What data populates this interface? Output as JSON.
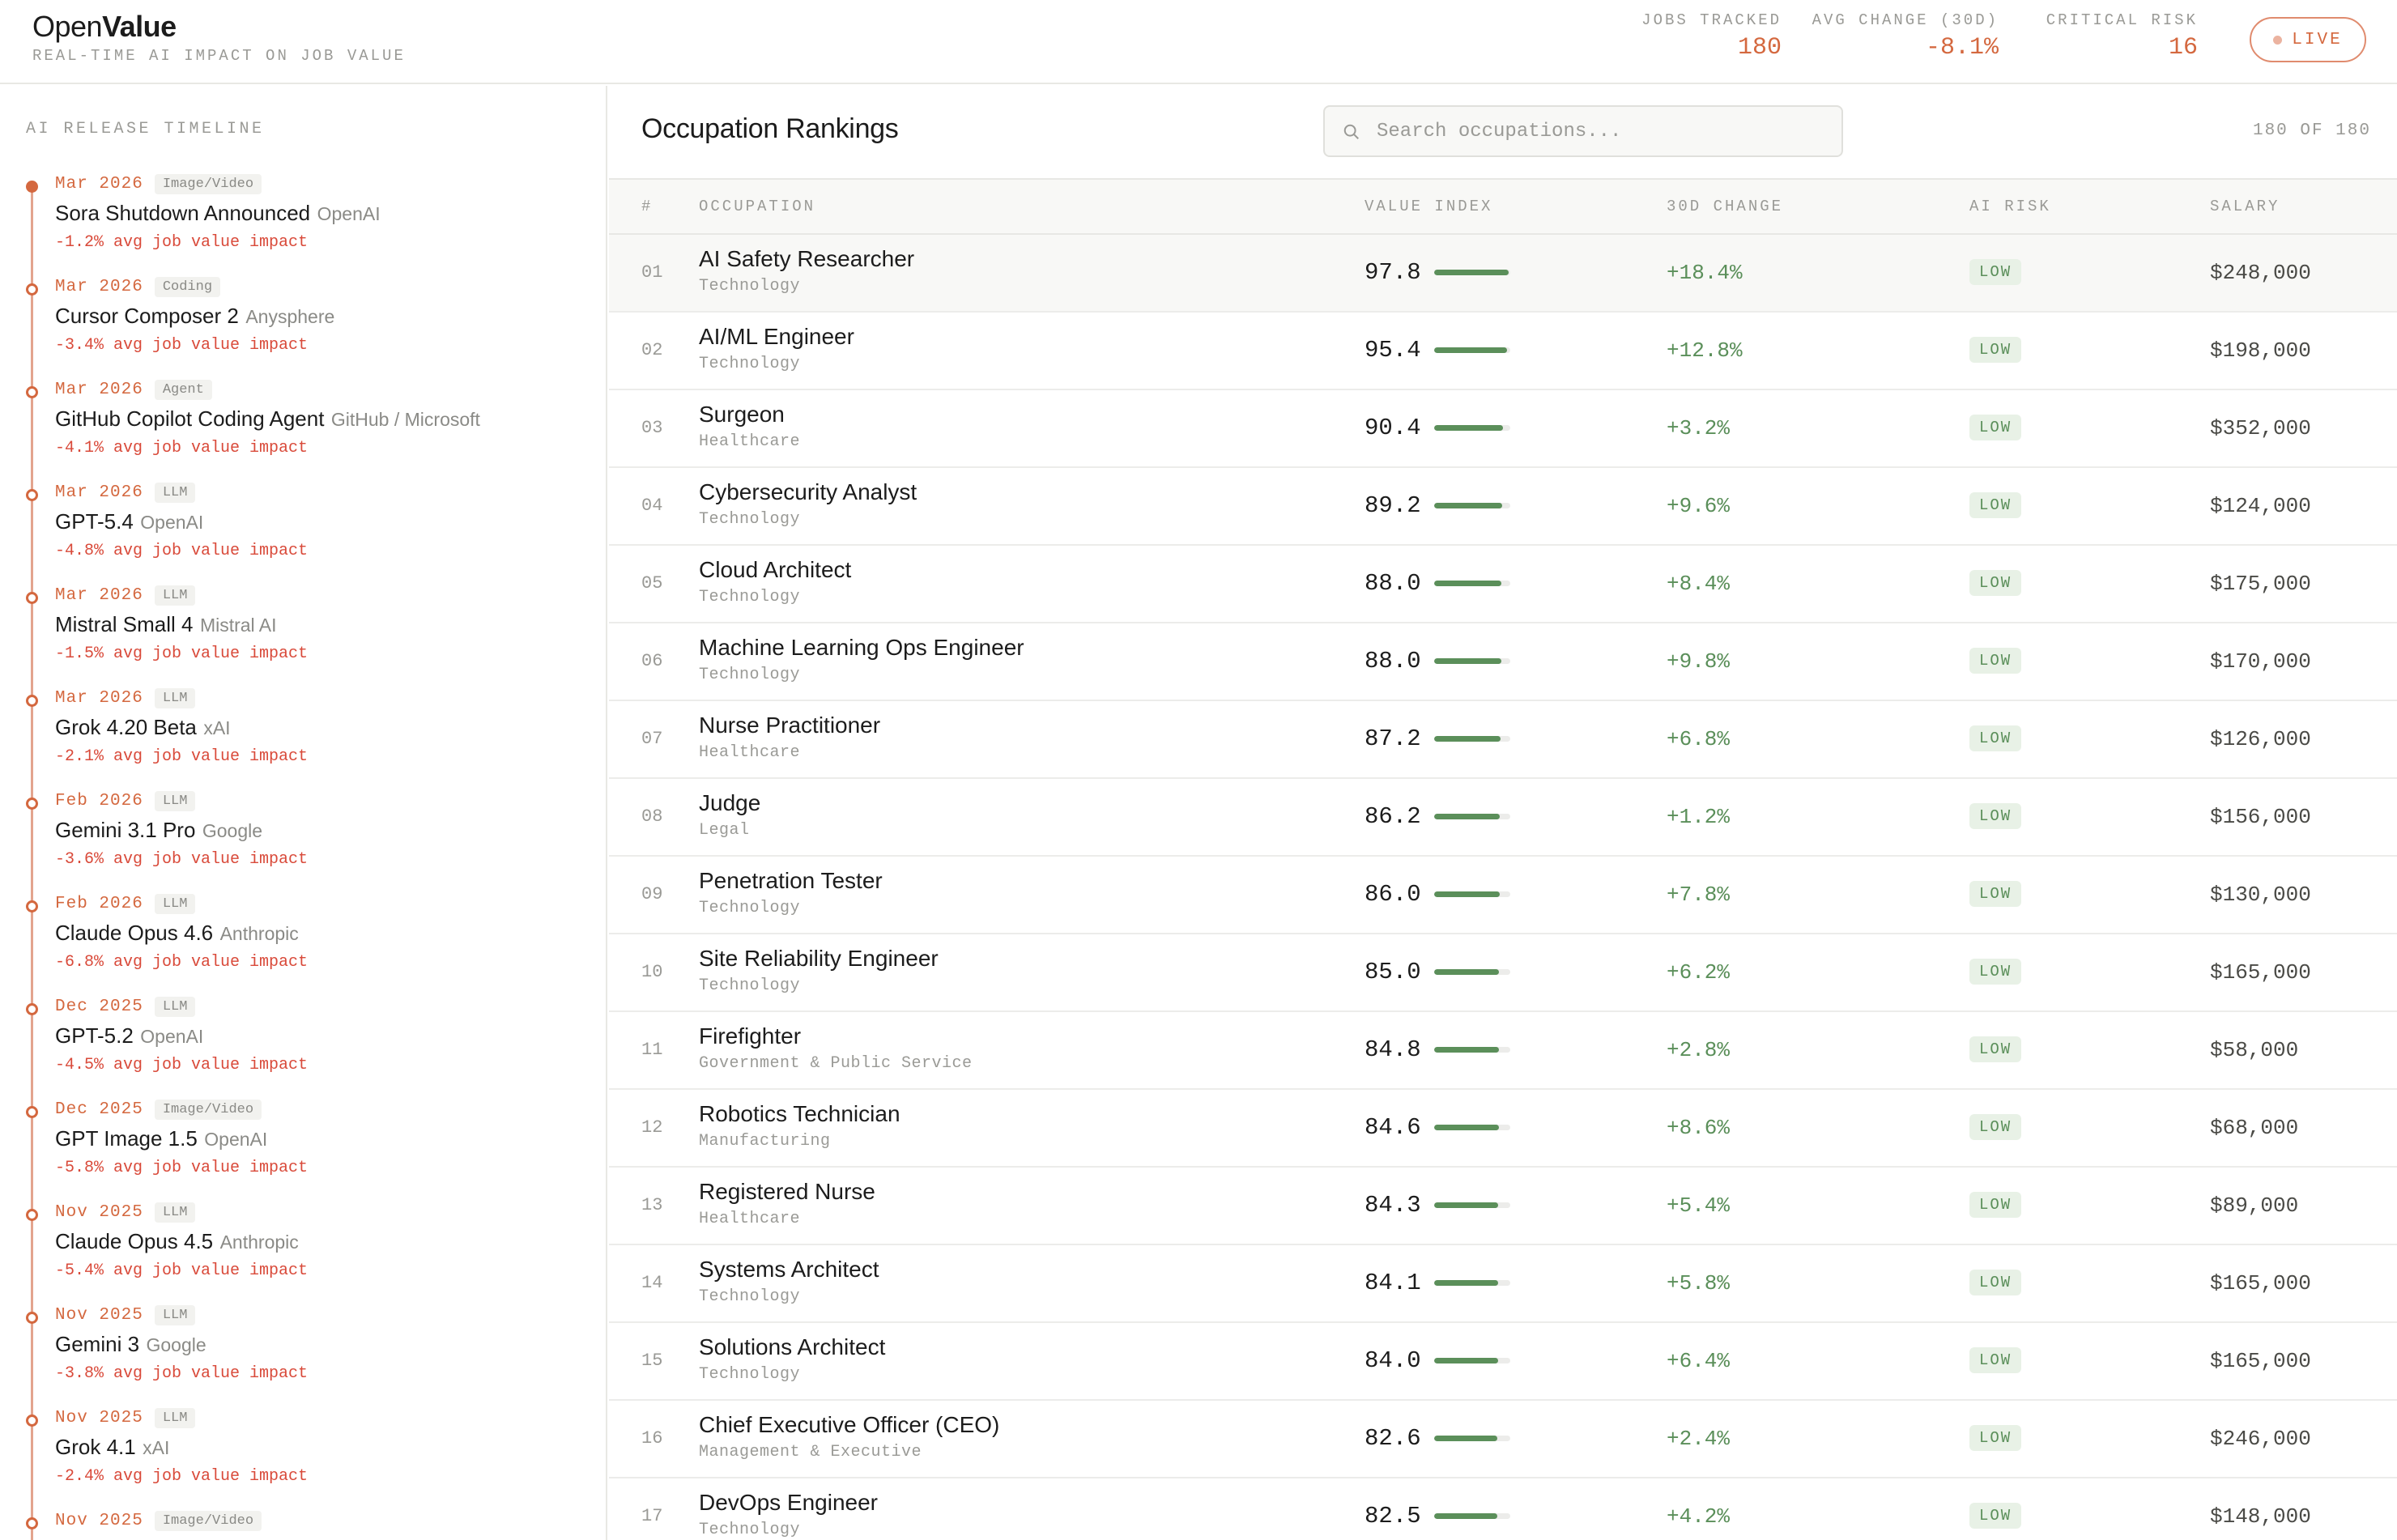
{
  "header": {
    "logo_part1": "Open",
    "logo_part2": "Value",
    "tagline": "REAL-TIME AI IMPACT ON JOB VALUE",
    "stats": [
      {
        "label": "JOBS TRACKED",
        "value": "180"
      },
      {
        "label": "AVG CHANGE (30D)",
        "value": "-8.1%"
      },
      {
        "label": "CRITICAL RISK",
        "value": "16"
      }
    ],
    "live_label": "LIVE"
  },
  "sidebar": {
    "title": "AI RELEASE TIMELINE",
    "items": [
      {
        "date": "Mar 2026",
        "tag": "Image/Video",
        "name": "Sora Shutdown Announced",
        "vendor": "OpenAI",
        "impact": "-1.2% avg job value impact"
      },
      {
        "date": "Mar 2026",
        "tag": "Coding",
        "name": "Cursor Composer 2",
        "vendor": "Anysphere",
        "impact": "-3.4% avg job value impact"
      },
      {
        "date": "Mar 2026",
        "tag": "Agent",
        "name": "GitHub Copilot Coding Agent",
        "vendor": "GitHub / Microsoft",
        "impact": "-4.1% avg job value impact"
      },
      {
        "date": "Mar 2026",
        "tag": "LLM",
        "name": "GPT-5.4",
        "vendor": "OpenAI",
        "impact": "-4.8% avg job value impact"
      },
      {
        "date": "Mar 2026",
        "tag": "LLM",
        "name": "Mistral Small 4",
        "vendor": "Mistral AI",
        "impact": "-1.5% avg job value impact"
      },
      {
        "date": "Mar 2026",
        "tag": "LLM",
        "name": "Grok 4.20 Beta",
        "vendor": "xAI",
        "impact": "-2.1% avg job value impact"
      },
      {
        "date": "Feb 2026",
        "tag": "LLM",
        "name": "Gemini 3.1 Pro",
        "vendor": "Google",
        "impact": "-3.6% avg job value impact"
      },
      {
        "date": "Feb 2026",
        "tag": "LLM",
        "name": "Claude Opus 4.6",
        "vendor": "Anthropic",
        "impact": "-6.8% avg job value impact"
      },
      {
        "date": "Dec 2025",
        "tag": "LLM",
        "name": "GPT-5.2",
        "vendor": "OpenAI",
        "impact": "-4.5% avg job value impact"
      },
      {
        "date": "Dec 2025",
        "tag": "Image/Video",
        "name": "GPT Image 1.5",
        "vendor": "OpenAI",
        "impact": "-5.8% avg job value impact"
      },
      {
        "date": "Nov 2025",
        "tag": "LLM",
        "name": "Claude Opus 4.5",
        "vendor": "Anthropic",
        "impact": "-5.4% avg job value impact"
      },
      {
        "date": "Nov 2025",
        "tag": "LLM",
        "name": "Gemini 3",
        "vendor": "Google",
        "impact": "-3.8% avg job value impact"
      },
      {
        "date": "Nov 2025",
        "tag": "LLM",
        "name": "Grok 4.1",
        "vendor": "xAI",
        "impact": "-2.4% avg job value impact"
      },
      {
        "date": "Nov 2025",
        "tag": "Image/Video",
        "name": "",
        "vendor": "",
        "impact": ""
      }
    ]
  },
  "main": {
    "title": "Occupation Rankings",
    "search_placeholder": "Search occupations...",
    "count": "180 OF 180",
    "columns": [
      "#",
      "OCCUPATION",
      "VALUE INDEX",
      "30D CHANGE",
      "AI RISK",
      "SALARY"
    ],
    "rows": [
      {
        "rank": "01",
        "name": "AI Safety Researcher",
        "sector": "Technology",
        "value": "97.8",
        "change": "+18.4%",
        "risk": "LOW",
        "salary": "$248,000"
      },
      {
        "rank": "02",
        "name": "AI/ML Engineer",
        "sector": "Technology",
        "value": "95.4",
        "change": "+12.8%",
        "risk": "LOW",
        "salary": "$198,000"
      },
      {
        "rank": "03",
        "name": "Surgeon",
        "sector": "Healthcare",
        "value": "90.4",
        "change": "+3.2%",
        "risk": "LOW",
        "salary": "$352,000"
      },
      {
        "rank": "04",
        "name": "Cybersecurity Analyst",
        "sector": "Technology",
        "value": "89.2",
        "change": "+9.6%",
        "risk": "LOW",
        "salary": "$124,000"
      },
      {
        "rank": "05",
        "name": "Cloud Architect",
        "sector": "Technology",
        "value": "88.0",
        "change": "+8.4%",
        "risk": "LOW",
        "salary": "$175,000"
      },
      {
        "rank": "06",
        "name": "Machine Learning Ops Engineer",
        "sector": "Technology",
        "value": "88.0",
        "change": "+9.8%",
        "risk": "LOW",
        "salary": "$170,000"
      },
      {
        "rank": "07",
        "name": "Nurse Practitioner",
        "sector": "Healthcare",
        "value": "87.2",
        "change": "+6.8%",
        "risk": "LOW",
        "salary": "$126,000"
      },
      {
        "rank": "08",
        "name": "Judge",
        "sector": "Legal",
        "value": "86.2",
        "change": "+1.2%",
        "risk": "LOW",
        "salary": "$156,000"
      },
      {
        "rank": "09",
        "name": "Penetration Tester",
        "sector": "Technology",
        "value": "86.0",
        "change": "+7.8%",
        "risk": "LOW",
        "salary": "$130,000"
      },
      {
        "rank": "10",
        "name": "Site Reliability Engineer",
        "sector": "Technology",
        "value": "85.0",
        "change": "+6.2%",
        "risk": "LOW",
        "salary": "$165,000"
      },
      {
        "rank": "11",
        "name": "Firefighter",
        "sector": "Government & Public Service",
        "value": "84.8",
        "change": "+2.8%",
        "risk": "LOW",
        "salary": "$58,000"
      },
      {
        "rank": "12",
        "name": "Robotics Technician",
        "sector": "Manufacturing",
        "value": "84.6",
        "change": "+8.6%",
        "risk": "LOW",
        "salary": "$68,000"
      },
      {
        "rank": "13",
        "name": "Registered Nurse",
        "sector": "Healthcare",
        "value": "84.3",
        "change": "+5.4%",
        "risk": "LOW",
        "salary": "$89,000"
      },
      {
        "rank": "14",
        "name": "Systems Architect",
        "sector": "Technology",
        "value": "84.1",
        "change": "+5.8%",
        "risk": "LOW",
        "salary": "$165,000"
      },
      {
        "rank": "15",
        "name": "Solutions Architect",
        "sector": "Technology",
        "value": "84.0",
        "change": "+6.4%",
        "risk": "LOW",
        "salary": "$165,000"
      },
      {
        "rank": "16",
        "name": "Chief Executive Officer (CEO)",
        "sector": "Management & Executive",
        "value": "82.6",
        "change": "+2.4%",
        "risk": "LOW",
        "salary": "$246,000"
      },
      {
        "rank": "17",
        "name": "DevOps Engineer",
        "sector": "Technology",
        "value": "82.5",
        "change": "+4.2%",
        "risk": "LOW",
        "salary": "$148,000"
      }
    ]
  },
  "colors": {
    "accent": "#d4683f",
    "negative": "#d94a3a",
    "positive": "#5b8f5a",
    "risk_low_bg": "#e8f1e6"
  }
}
